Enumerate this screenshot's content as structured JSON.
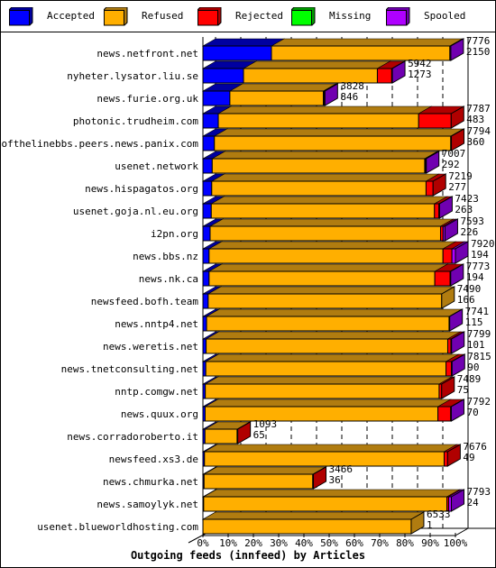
{
  "chart_data": {
    "type": "bar",
    "orientation": "horizontal",
    "stacked": true,
    "style": "3d",
    "title": "Outgoing feeds (innfeed) by Articles",
    "xlabel": "",
    "ylabel": "",
    "xlim": [
      0,
      7920
    ],
    "x_tick_labels": [
      "0%",
      "10%",
      "20%",
      "30%",
      "40%",
      "50%",
      "60%",
      "70%",
      "80%",
      "90%",
      "100%"
    ],
    "grid": true,
    "legend_position": "top",
    "legend": [
      {
        "name": "Accepted",
        "color": "#0000ff",
        "side": "#0000a0"
      },
      {
        "name": "Refused",
        "color": "#ffaf00",
        "side": "#b07c10"
      },
      {
        "name": "Rejected",
        "color": "#ff0000",
        "side": "#b00000"
      },
      {
        "name": "Missing",
        "color": "#00ff00",
        "side": "#00a000"
      },
      {
        "name": "Spooled",
        "color": "#af00ff",
        "side": "#7000b0"
      }
    ],
    "categories": [
      "news.netfront.net",
      "nyheter.lysator.liu.se",
      "news.furie.org.uk",
      "photonic.trudheim.com",
      "endofthelinebbs.peers.news.panix.com",
      "usenet.network",
      "news.hispagatos.org",
      "usenet.goja.nl.eu.org",
      "i2pn.org",
      "news.bbs.nz",
      "news.nk.ca",
      "newsfeed.bofh.team",
      "news.nntp4.net",
      "news.weretis.net",
      "news.tnetconsulting.net",
      "nntp.comgw.net",
      "news.quux.org",
      "news.corradoroberto.it",
      "newsfeed.xs3.de",
      "news.chmurka.net",
      "news.samoylyk.net",
      "usenet.blueworldhosting.com"
    ],
    "totals": [
      7776,
      5942,
      3828,
      7787,
      7794,
      7007,
      7219,
      7423,
      7593,
      7920,
      7773,
      7490,
      7741,
      7799,
      7815,
      7489,
      7792,
      1093,
      7676,
      3466,
      7793,
      6533
    ],
    "accepted": [
      2150,
      1273,
      846,
      483,
      360,
      292,
      277,
      263,
      226,
      194,
      194,
      166,
      115,
      101,
      90,
      75,
      70,
      65,
      49,
      36,
      24,
      1
    ],
    "series": [
      {
        "name": "Accepted",
        "values": [
          2150,
          1273,
          846,
          483,
          360,
          292,
          277,
          263,
          226,
          194,
          194,
          166,
          115,
          101,
          90,
          75,
          70,
          65,
          49,
          36,
          24,
          1
        ]
      },
      {
        "name": "Refused",
        "values": [
          5596,
          4199,
          2932,
          6284,
          7414,
          6665,
          6722,
          7000,
          7227,
          7336,
          7079,
          7324,
          7606,
          7578,
          7535,
          7334,
          7302,
          1008,
          7517,
          3410,
          7629,
          6532
        ]
      },
      {
        "name": "Rejected",
        "values": [
          0,
          450,
          30,
          1020,
          20,
          30,
          220,
          140,
          80,
          280,
          480,
          0,
          0,
          100,
          170,
          80,
          400,
          20,
          110,
          20,
          55,
          0
        ]
      },
      {
        "name": "Missing",
        "values": [
          0,
          0,
          0,
          0,
          0,
          0,
          0,
          0,
          0,
          0,
          0,
          0,
          0,
          0,
          0,
          0,
          0,
          0,
          0,
          0,
          0,
          0
        ]
      },
      {
        "name": "Spooled",
        "values": [
          30,
          20,
          20,
          0,
          0,
          20,
          0,
          20,
          60,
          110,
          20,
          0,
          20,
          20,
          20,
          0,
          20,
          0,
          0,
          0,
          85,
          0
        ]
      }
    ]
  }
}
